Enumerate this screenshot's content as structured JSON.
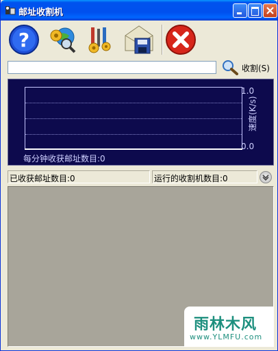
{
  "window": {
    "title": "邮址收割机",
    "colors": {
      "titlebar": "#0053ee",
      "graph_bg": "#0d0a4d",
      "close": "#c4401d"
    }
  },
  "toolbar": {
    "items": [
      {
        "icon": "help-icon"
      },
      {
        "icon": "settings-globe-icon"
      },
      {
        "icon": "tools-icon"
      },
      {
        "icon": "mail-save-icon"
      },
      {
        "icon": "close-x-icon"
      }
    ]
  },
  "address_input": {
    "value": ""
  },
  "harvest_button": {
    "label": "收割(S)",
    "icon": "search-magnifier-icon"
  },
  "graph": {
    "y_ticks": [
      "1.0",
      "0.0"
    ],
    "y_label": "速度(K/s)",
    "caption": "每分钟收获邮址数目:0"
  },
  "status": {
    "harvested": "已收获邮址数目:0",
    "running": "运行的收割机数目:0"
  },
  "watermark": {
    "main": "雨林木风",
    "url": "www.YLMFU.com"
  }
}
